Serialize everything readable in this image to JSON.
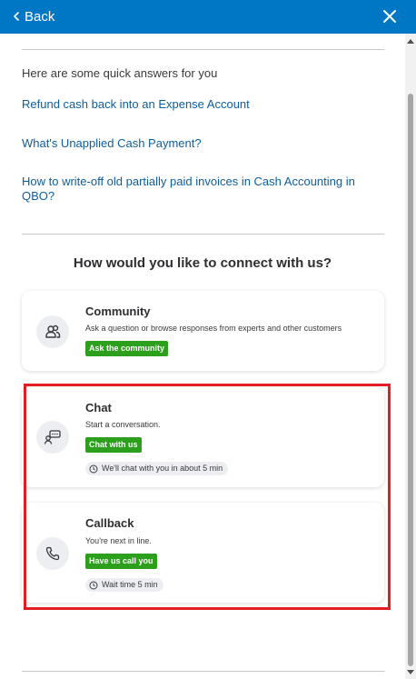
{
  "header": {
    "back_label": "Back",
    "close_icon": "close-icon",
    "background": "#0077c5"
  },
  "quick_answers": {
    "intro": "Here are some quick answers for you",
    "links": [
      "Refund cash back into an Expense Account",
      "What's Unapplied Cash Payment?",
      "How to write-off old partially paid invoices in Cash Accounting in QBO?"
    ]
  },
  "connect": {
    "title": "How would you like to connect with us?",
    "options": [
      {
        "title": "Community",
        "description": "Ask a question or browse responses from experts and other customers",
        "action": "Ask the community",
        "icon": "people-icon"
      },
      {
        "title": "Chat",
        "description": "Start a conversation.",
        "action": "Chat with us",
        "wait": "We'll chat with you in about 5 min",
        "icon": "chat-bubble-icon"
      },
      {
        "title": "Callback",
        "description": "You're next in line.",
        "action": "Have us call you",
        "wait": "Wait time 5 min",
        "icon": "phone-icon"
      }
    ]
  },
  "colors": {
    "link": "#0d5e9e",
    "action_green": "#2ca01c",
    "highlight_red": "#e51c23"
  }
}
